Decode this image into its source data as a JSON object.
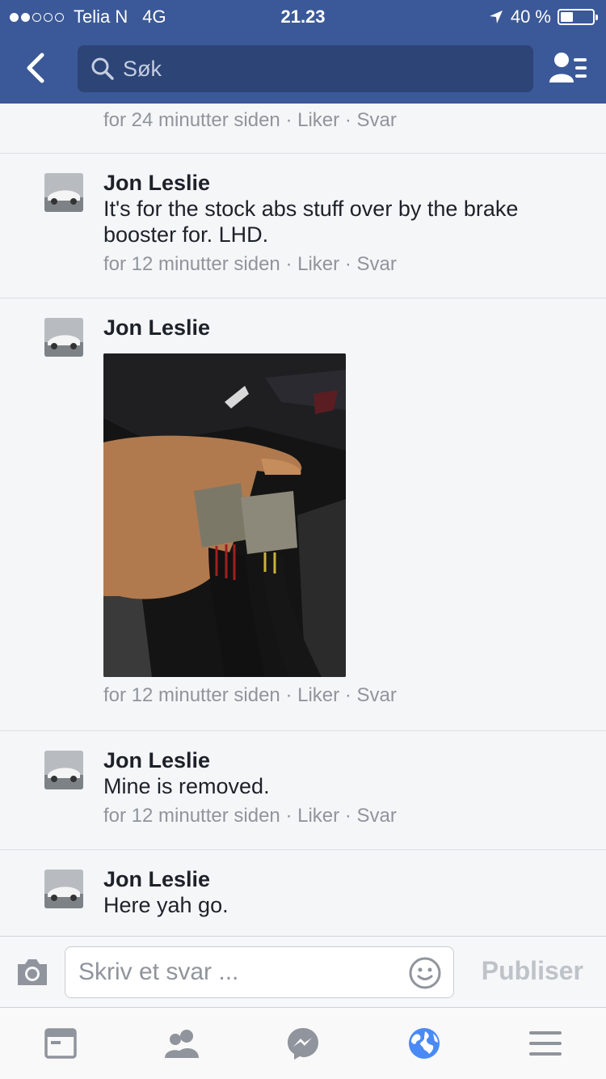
{
  "status_bar": {
    "carrier": "Telia N",
    "network": "4G",
    "time": "21.23",
    "battery_text": "40 %",
    "battery_level": 0.4
  },
  "nav": {
    "search_placeholder": "Søk",
    "back_icon": "chevron-left-icon",
    "friends_icon": "friends-list-icon"
  },
  "comments": [
    {
      "meta": {
        "time": "for 24 minutter siden",
        "like": "Liker",
        "reply": "Svar"
      }
    },
    {
      "name": "Jon Leslie",
      "text": "It's for the stock abs stuff over by the brake booster for. LHD.",
      "meta": {
        "time": "for 12 minutter siden",
        "like": "Liker",
        "reply": "Svar"
      }
    },
    {
      "name": "Jon Leslie",
      "meta": {
        "time": "for 12 minutter siden",
        "like": "Liker",
        "reply": "Svar"
      }
    },
    {
      "name": "Jon Leslie",
      "text": "Mine is removed.",
      "meta": {
        "time": "for 12 minutter siden",
        "like": "Liker",
        "reply": "Svar"
      }
    },
    {
      "name": "Jon Leslie",
      "text": "Here yah go."
    }
  ],
  "reply_bar": {
    "placeholder": "Skriv et svar ...",
    "publish_label": "Publiser"
  },
  "tabs": [
    "news-feed-icon",
    "friends-icon",
    "messenger-icon",
    "globe-icon",
    "menu-icon"
  ],
  "colors": {
    "brand": "#3b5998",
    "active_tab": "#4a8af4",
    "meta": "#90949c"
  }
}
